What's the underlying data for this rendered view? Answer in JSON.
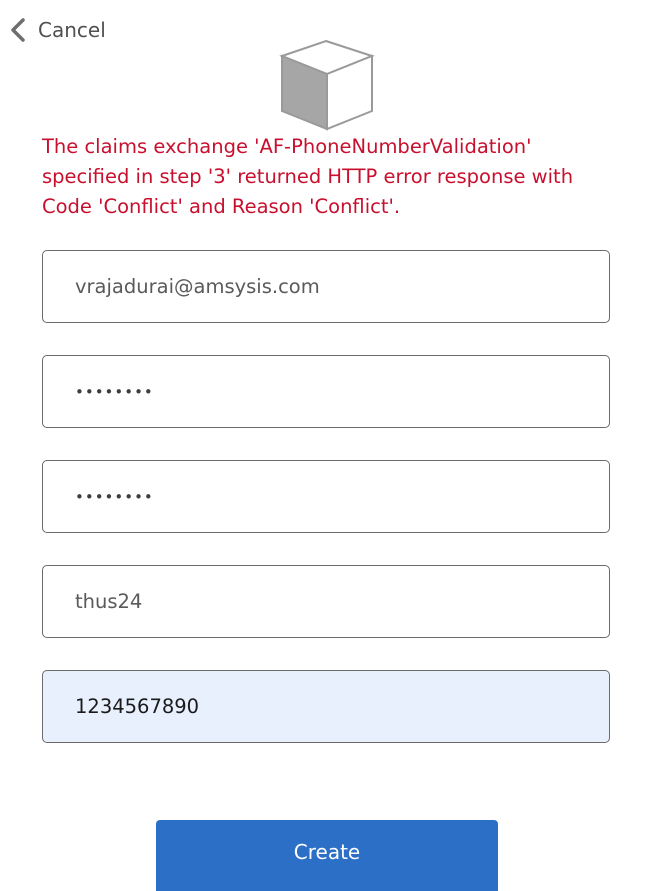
{
  "header": {
    "cancel_label": "Cancel",
    "back_icon": "chevron-left-icon",
    "logo_icon": "cube-logo-icon"
  },
  "error": {
    "message": "The claims exchange 'AF-PhoneNumberValidation' specified in step '3' returned HTTP error response with Code 'Conflict' and Reason 'Conflict'.",
    "color": "#c8102e"
  },
  "form": {
    "email_value": "vrajadurai@amsysis.com",
    "password_value": "••••••••",
    "confirm_password_value": "••••••••",
    "username_value": "thus24",
    "phone_value": "1234567890",
    "create_label": "Create"
  },
  "colors": {
    "accent": "#2b6fc7",
    "autofill_background": "#e8f0fe"
  }
}
